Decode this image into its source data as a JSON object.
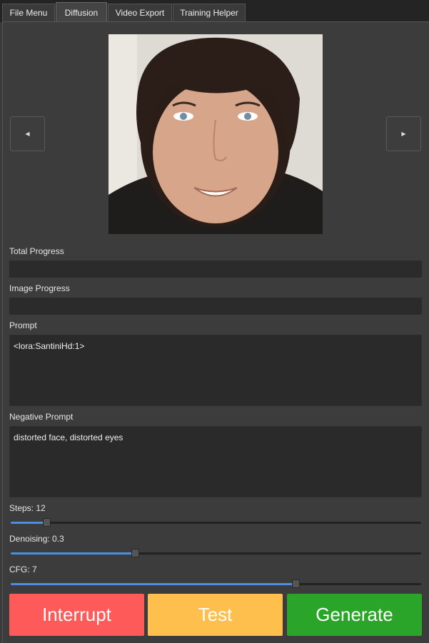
{
  "tabs": [
    {
      "label": "File Menu"
    },
    {
      "label": "Diffusion"
    },
    {
      "label": "Video Export"
    },
    {
      "label": "Training Helper"
    }
  ],
  "nav": {
    "prev_glyph": "◀",
    "next_glyph": "▶"
  },
  "labels": {
    "total_progress": "Total Progress",
    "image_progress": "Image Progress",
    "prompt": "Prompt",
    "negative_prompt": "Negative Prompt"
  },
  "progress": {
    "total": 0,
    "image": 0
  },
  "prompt": {
    "value": "<lora:SantiniHd:1>"
  },
  "negative_prompt": {
    "value": "distorted face, distorted eyes"
  },
  "sliders": {
    "steps": {
      "label": "Steps: 12",
      "fraction": 0.088
    },
    "denoising": {
      "label": "Denoising: 0.3",
      "fraction": 0.305
    },
    "cfg": {
      "label": "CFG: 7",
      "fraction": 0.695
    }
  },
  "buttons": {
    "interrupt": "Interrupt",
    "test": "Test",
    "generate": "Generate"
  },
  "colors": {
    "accent": "#4a90e2",
    "interrupt": "#ff5a5a",
    "test": "#ffbf4d",
    "generate": "#2aa52a"
  }
}
